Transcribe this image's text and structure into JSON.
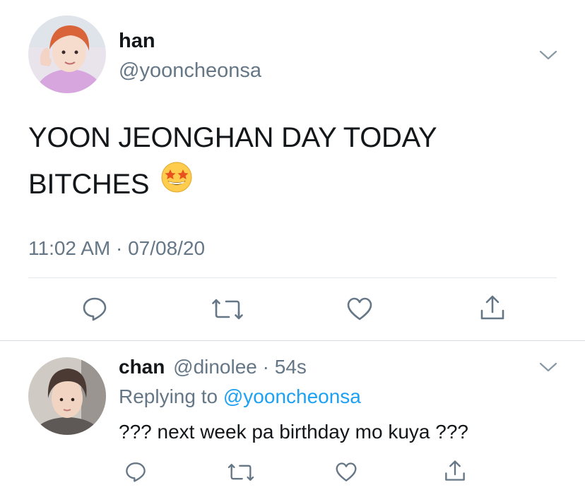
{
  "tweet": {
    "display_name": "han",
    "handle": "@yooncheonsa",
    "text_line1": "YOON JEONGHAN DAY TODAY",
    "text_line2": "BITCHES",
    "emoji": "star-struck-emoji",
    "timestamp": "11:02 AM · 07/08/20"
  },
  "reply": {
    "display_name": "chan",
    "handle": "@dinolee",
    "time": "· 54s",
    "replying_prefix": "Replying to",
    "replying_mention": "@yooncheonsa",
    "text": "??? next week pa birthday mo kuya ???"
  },
  "icons": {
    "chevron": "chevron-down-icon",
    "reply": "reply-icon",
    "retweet": "retweet-icon",
    "like": "heart-icon",
    "share": "share-icon"
  },
  "colors": {
    "text": "#14171a",
    "secondary": "#657786",
    "link": "#1da1f2",
    "divider": "#e1e8ed"
  }
}
